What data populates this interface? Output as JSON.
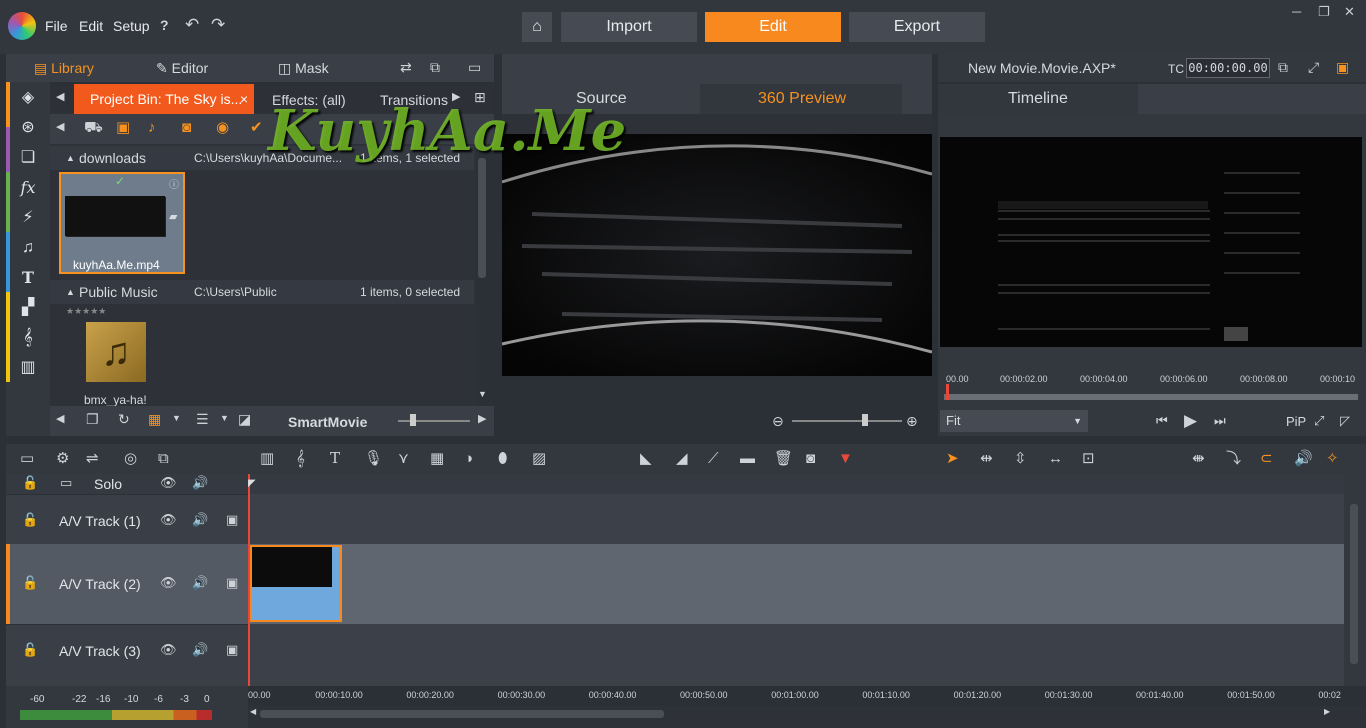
{
  "menu": [
    "File",
    "Edit",
    "Setup"
  ],
  "nav": {
    "import": "Import",
    "edit": "Edit",
    "export": "Export"
  },
  "library": {
    "tabs": [
      "Library",
      "Editor",
      "Mask"
    ],
    "bin_tabs": {
      "project": "Project Bin: The Sky is...",
      "close": "×",
      "effects": "Effects: (all)",
      "transitions": "Transitions"
    },
    "groups": [
      {
        "title": "downloads",
        "path": "C:\\Users\\kuyhAa\\Docume...",
        "count": "1 items, 1 selected",
        "item": "kuyhAa.Me.mp4"
      },
      {
        "title": "Public Music",
        "path": "C:\\Users\\Public",
        "count": "1 items, 0 selected",
        "item": "bmx_ya-ha!"
      }
    ],
    "smartmovie": "SmartMovie"
  },
  "watermark": "KuyhAa.Me",
  "preview": {
    "tabs": [
      "Source",
      "360 Preview"
    ]
  },
  "timeline_viewer": {
    "title": "New Movie.Movie.AXP*",
    "tc_label": "TC",
    "tc_value": "00:00:00.00",
    "tab": "Timeline",
    "ruler": [
      "00.00",
      "00:00:02.00",
      "00:00:04.00",
      "00:00:06.00",
      "00:00:08.00",
      "00:00:10"
    ],
    "fit": "Fit",
    "pip": "PiP"
  },
  "tracks": [
    {
      "name": "Solo"
    },
    {
      "name": "A/V Track (1)"
    },
    {
      "name": "A/V Track (2)"
    },
    {
      "name": "A/V Track (3)"
    }
  ],
  "timeline_ruler": [
    "00.00",
    "00:00:10.00",
    "00:00:20.00",
    "00:00:30.00",
    "00:00:40.00",
    "00:00:50.00",
    "00:01:00.00",
    "00:01:10.00",
    "00:01:20.00",
    "00:01:30.00",
    "00:01:40.00",
    "00:01:50.00",
    "00:02"
  ],
  "meter_labels": [
    "-60",
    "-22",
    "-16",
    "-10",
    "-6",
    "-3",
    "0"
  ],
  "colors": {
    "accent": "#f7891f",
    "project_tab": "#f25a1d",
    "clip": "#6fa8dc"
  }
}
